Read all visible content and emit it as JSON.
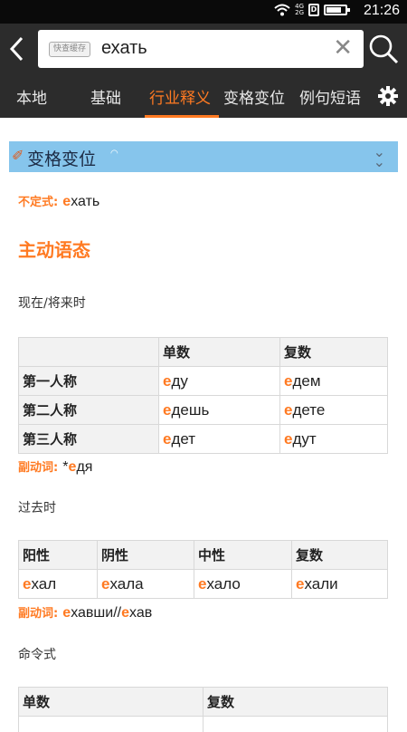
{
  "status_bar": {
    "time": "21:26",
    "network": [
      "4G",
      "2G"
    ],
    "sim_label": "D",
    "battery_level": 0.8
  },
  "toolbar": {
    "search_tag": "快查缓存",
    "query": "ехать",
    "clear_symbol": "✕"
  },
  "tabs": [
    {
      "label": "本地",
      "active": false
    },
    {
      "label": "基础",
      "active": false
    },
    {
      "label": "行业释义",
      "active": true
    },
    {
      "label": "变格变位",
      "active": false
    },
    {
      "label": "例句短语",
      "active": false
    }
  ],
  "section": {
    "title": "变格变位",
    "collapse_symbol": "⌄⌄"
  },
  "infinitive": {
    "label": "不定式:",
    "stress_letter": "е",
    "rest": "хать"
  },
  "voice_title": "主动语态",
  "present": {
    "label": "现在/将来时",
    "headers": [
      "",
      "单数",
      "复数"
    ],
    "rows": [
      {
        "person": "第一人称",
        "sg_stress": "е",
        "sg_rest": "ду",
        "pl_stress": "е",
        "pl_rest": "дем"
      },
      {
        "person": "第二人称",
        "sg_stress": "е",
        "sg_rest": "дешь",
        "pl_stress": "е",
        "pl_rest": "дете"
      },
      {
        "person": "第三人称",
        "sg_stress": "е",
        "sg_rest": "дет",
        "pl_stress": "е",
        "pl_rest": "дут"
      }
    ],
    "gerund": {
      "label": "副动词:",
      "prefix": "*",
      "stress_letter": "е",
      "rest": "дя"
    }
  },
  "past": {
    "label": "过去时",
    "headers": [
      "阳性",
      "阴性",
      "中性",
      "复数"
    ],
    "forms": [
      {
        "stress": "е",
        "rest": "хал"
      },
      {
        "stress": "е",
        "rest": "хала"
      },
      {
        "stress": "е",
        "rest": "хало"
      },
      {
        "stress": "е",
        "rest": "хали"
      }
    ],
    "gerund": {
      "label": "副动词:",
      "stress_letter": "е",
      "rest": "хавши//",
      "stress_letter_2": "е",
      "rest_2": "хав"
    }
  },
  "imperative": {
    "label": "命令式",
    "headers": [
      "单数",
      "复数"
    ]
  },
  "colors": {
    "accent": "#ff7a22",
    "header_bg": "#2c2c2c",
    "section_bg": "#86c5ec"
  },
  "icons": [
    "back-arrow-icon",
    "search-icon",
    "clear-icon",
    "settings-gear-icon",
    "pen-icon",
    "double-chevron-down-icon",
    "wifi-icon",
    "battery-icon"
  ]
}
